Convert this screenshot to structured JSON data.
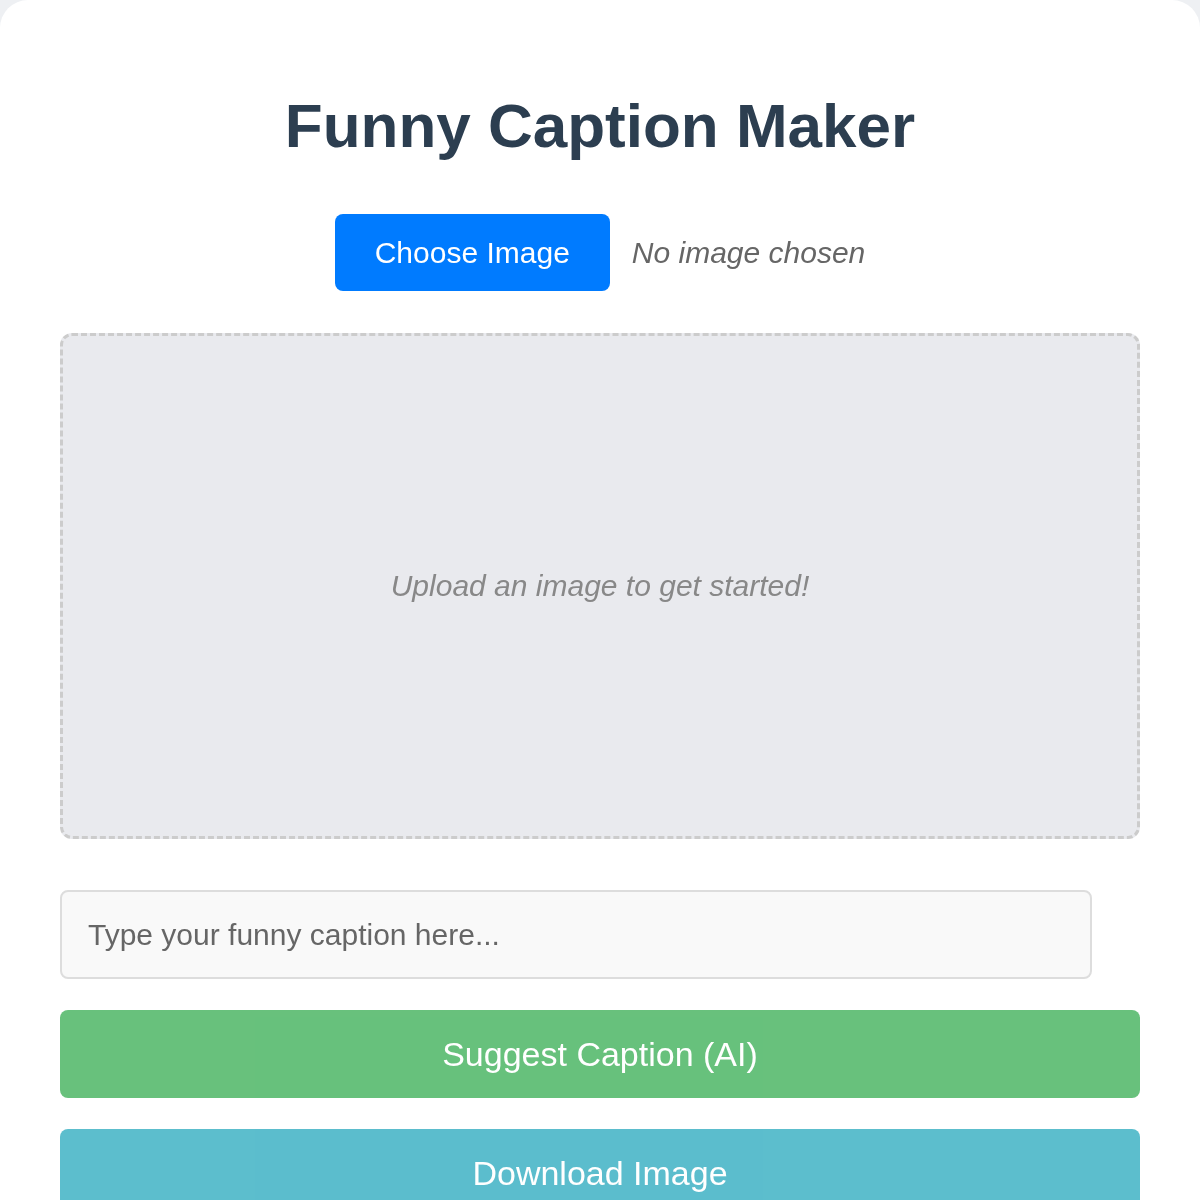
{
  "title": "Funny Caption Maker",
  "file_picker": {
    "button": "Choose Image",
    "status": "No image chosen"
  },
  "preview": {
    "placeholder": "Upload an image to get started!"
  },
  "caption_field": {
    "placeholder": "Type your funny caption here..."
  },
  "buttons": [
    {
      "label": "Suggest Caption (AI)",
      "kind": "suggest",
      "disabled": true
    },
    {
      "label": "Download Image",
      "kind": "download",
      "disabled": true
    }
  ]
}
